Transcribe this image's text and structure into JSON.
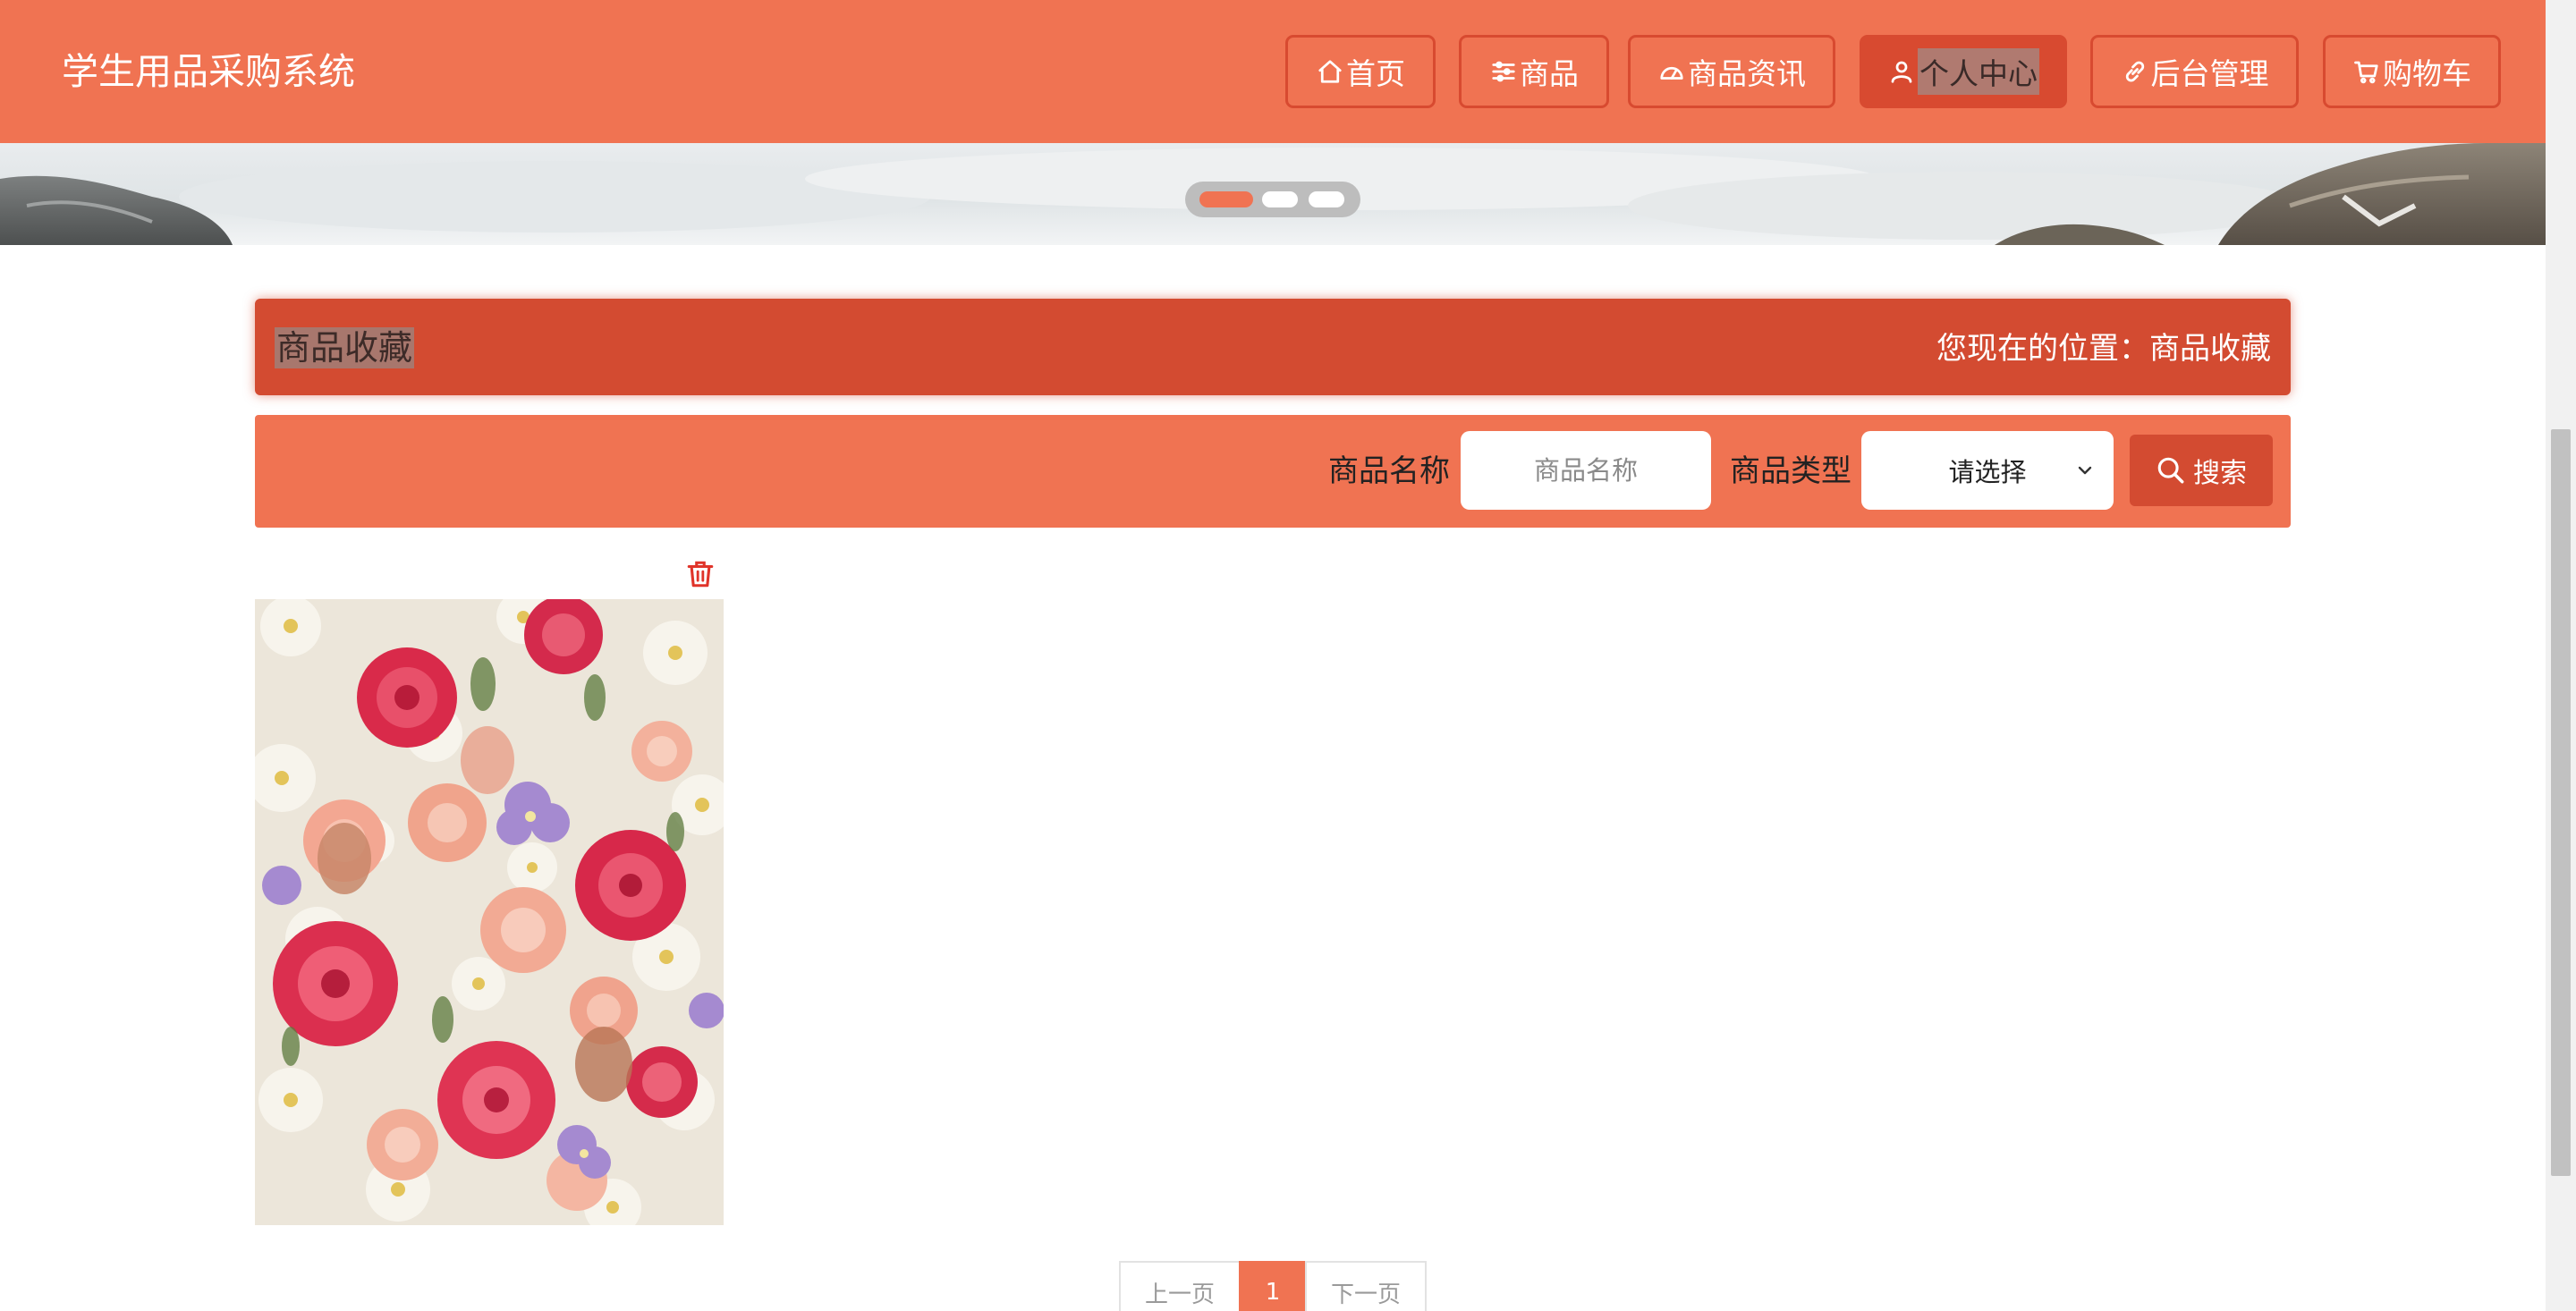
{
  "header": {
    "site_title": "学生用品采购系统",
    "nav": [
      {
        "label": "首页",
        "icon": "home-icon"
      },
      {
        "label": "商品",
        "icon": "sliders-icon"
      },
      {
        "label": "商品资讯",
        "icon": "gauge-icon"
      },
      {
        "label": "个人中心",
        "icon": "user-icon",
        "active": true
      },
      {
        "label": "后台管理",
        "icon": "link-icon"
      },
      {
        "label": "购物车",
        "icon": "cart-icon"
      }
    ]
  },
  "banner": {
    "active_slide": 1,
    "slide_count": 3
  },
  "title_bar": {
    "title": "商品收藏",
    "location": "您现在的位置：商品收藏"
  },
  "search": {
    "name_label": "商品名称",
    "name_placeholder": "商品名称",
    "type_label": "商品类型",
    "type_selected": "请选择",
    "search_button": "搜索"
  },
  "favorites": [
    {
      "image": "flower-bouquet-photo",
      "delete_icon": "trash-icon"
    }
  ],
  "pagination": {
    "prev": "上一页",
    "current": "1",
    "next": "下一页"
  },
  "colors": {
    "primary": "#f07352",
    "accent": "#d34b31",
    "white": "#ffffff"
  }
}
